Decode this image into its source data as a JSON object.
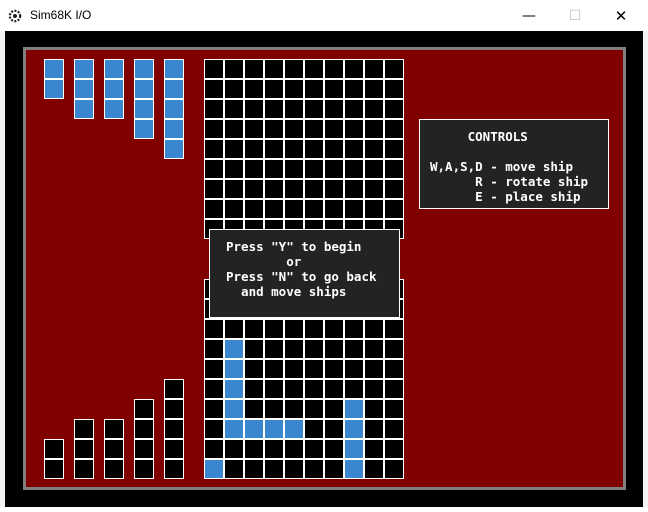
{
  "window": {
    "title": "Sim68K I/O",
    "minimize_glyph": "—",
    "maximize_glyph": "☐",
    "close_glyph": "✕"
  },
  "colors": {
    "board_bg": "#800000",
    "cell_empty": "#000000",
    "cell_ship": "#3a86cf",
    "cell_border": "#ffffff",
    "panel_bg": "#232323"
  },
  "game": {
    "grid_size": 10,
    "fleet_lengths": [
      2,
      3,
      3,
      4,
      5
    ],
    "top_grid_visible_rows": 9,
    "bottom_grid_placed": [
      [
        1,
        3
      ],
      [
        1,
        4
      ],
      [
        1,
        5
      ],
      [
        1,
        6
      ],
      [
        1,
        7
      ],
      [
        2,
        7
      ],
      [
        3,
        7
      ],
      [
        4,
        7
      ],
      [
        7,
        6
      ],
      [
        7,
        7
      ],
      [
        7,
        8
      ],
      [
        7,
        9
      ],
      [
        0,
        9
      ],
      [
        0,
        10
      ]
    ]
  },
  "controls_panel": {
    "text": "     CONTROLS\n\nW,A,S,D - move ship\n      R - rotate ship\n      E - place ship"
  },
  "prompt": {
    "text": "Press \"Y\" to begin\n        or\nPress \"N\" to go back\n  and move ships"
  }
}
